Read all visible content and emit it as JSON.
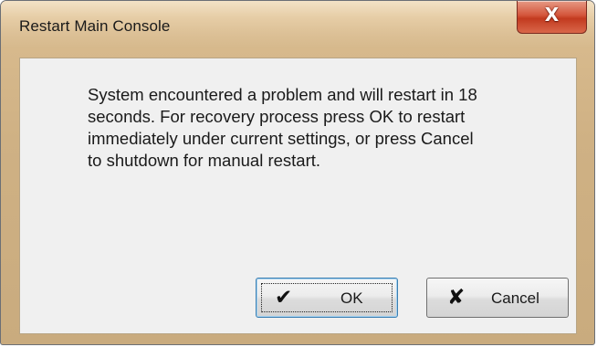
{
  "window": {
    "title": "Restart Main Console",
    "close_glyph": "X"
  },
  "message": {
    "lines": [
      "System encountered a problem and will restart in 18",
      "seconds. For recovery process press OK to restart",
      "immediately under current settings, or press Cancel",
      "to shutdown for manual restart."
    ]
  },
  "buttons": {
    "ok": {
      "label": "OK",
      "icon": "checkmark-icon",
      "glyph": "✔"
    },
    "cancel": {
      "label": "Cancel",
      "icon": "cross-icon",
      "glyph": "✘"
    }
  },
  "colors": {
    "frame": "#d6b98c",
    "close_button": "#c23a1f",
    "client_background": "#f0f0f0"
  }
}
